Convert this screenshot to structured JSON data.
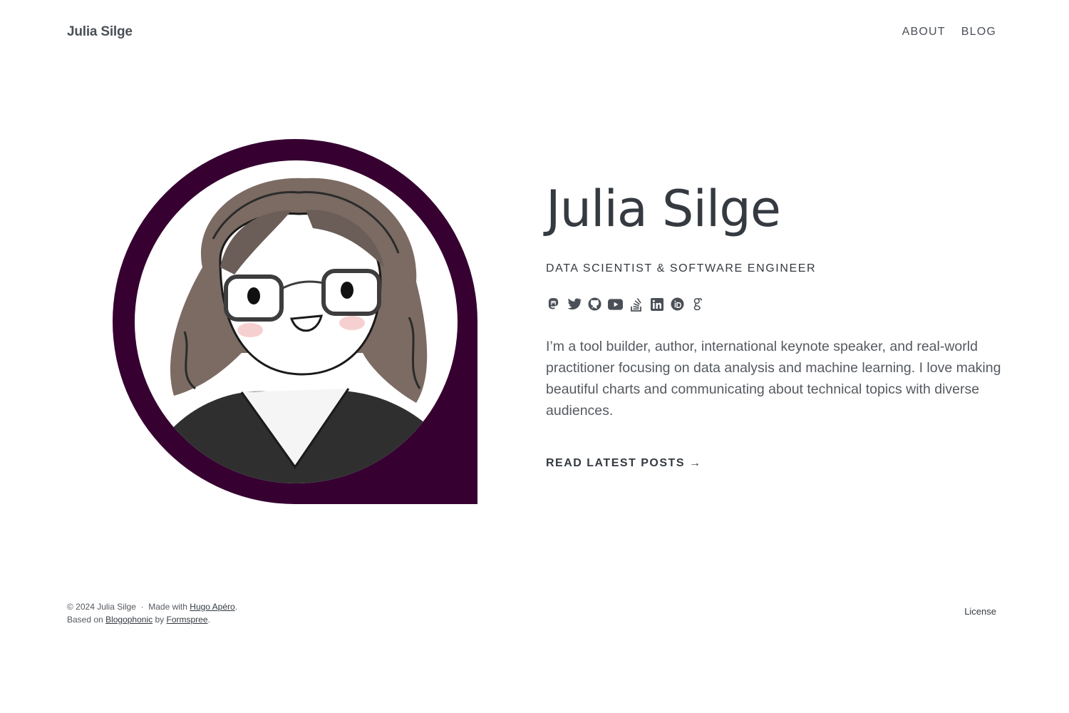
{
  "header": {
    "site_title": "Julia Silge",
    "nav": [
      {
        "label": "ABOUT"
      },
      {
        "label": "BLOG"
      }
    ]
  },
  "hero": {
    "name": "Julia Silge",
    "subtitle": "DATA SCIENTIST & SOFTWARE ENGINEER",
    "social_icons": [
      "mastodon-icon",
      "twitter-icon",
      "github-icon",
      "youtube-icon",
      "stackoverflow-icon",
      "linkedin-icon",
      "orcid-icon",
      "google-scholar-icon"
    ],
    "bio": "I’m a tool builder, author, international keynote speaker, and real-world practitioner focusing on data analysis and machine learning. I love making beautiful charts and communicating about technical topics with diverse audiences.",
    "cta_label": "READ LATEST POSTS →"
  },
  "footer": {
    "copyright": "© 2024 Julia Silge",
    "separator": "·",
    "made_with": "Made with",
    "hugo_link": "Hugo Apéro",
    "based_on": "Based on",
    "blogophonic_link": "Blogophonic",
    "by": "by",
    "formspree_link": "Formspree",
    "period": ".",
    "license_label": "License"
  },
  "colors": {
    "avatar_background": "#360031",
    "text": "#343a40",
    "muted_text": "#555a60"
  }
}
